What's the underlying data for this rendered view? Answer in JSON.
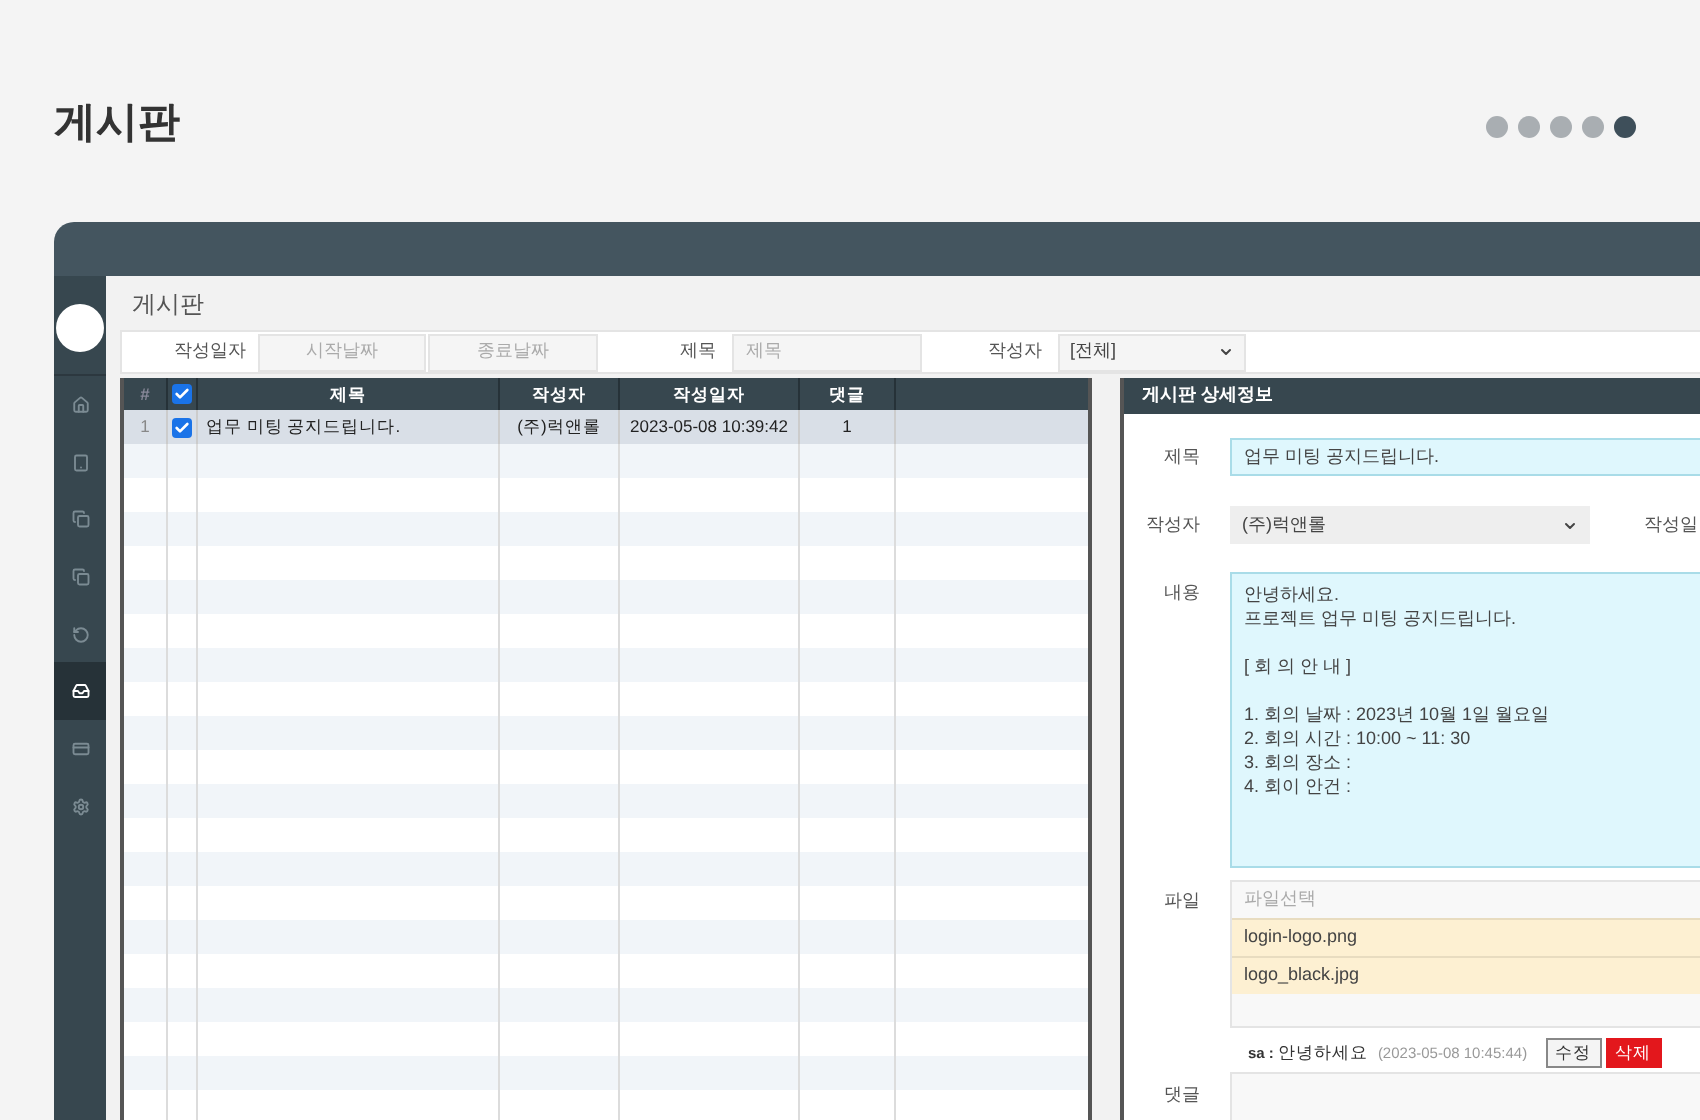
{
  "page_title": "게시판",
  "pager_dots": [
    {
      "selected": false
    },
    {
      "selected": false
    },
    {
      "selected": false
    },
    {
      "selected": false
    },
    {
      "selected": true
    }
  ],
  "sidebar": {
    "items": [
      {
        "selected": false
      },
      {
        "selected": false
      },
      {
        "selected": false
      },
      {
        "selected": false
      },
      {
        "selected": false
      },
      {
        "selected": true
      },
      {
        "selected": false
      },
      {
        "selected": false
      }
    ]
  },
  "board_title": "게시판",
  "filters": {
    "date_label": "작성일자",
    "start_placeholder": "시작날짜",
    "end_placeholder": "종료날짜",
    "title_label": "제목",
    "title_placeholder": "제목",
    "author_label": "작성자",
    "author_value": "[전체]"
  },
  "table": {
    "columns": [
      "#",
      "제목",
      "작성자",
      "작성일자",
      "댓글"
    ],
    "header_checked": true,
    "rows": [
      {
        "num": "1",
        "checked": true,
        "selected": true,
        "title": "업무 미팅 공지드립니다.",
        "author": "(주)럭앤롤",
        "date": "2023-05-08 10:39:42",
        "comments": "1"
      }
    ]
  },
  "detail": {
    "header": "게시판 상세정보",
    "title_label": "제목",
    "title_value": "업무 미팅 공지드립니다.",
    "author_label": "작성자",
    "author_value": "(주)럭앤롤",
    "date_label": "작성일",
    "content_label": "내용",
    "content_paragraphs": [
      [
        "안녕하세요.",
        "프로젝트 업무 미팅 공지드립니다."
      ],
      [
        "[ 회 의 안 내 ]"
      ],
      [
        "1. 회의 날짜 : 2023년 10월 1일 월요일",
        "2. 회의 시간 : 10:00 ~ 11: 30",
        "3. 회의 장소 :",
        "4. 회이 안건 :"
      ]
    ],
    "file_label": "파일",
    "file_placeholder": "파일선택",
    "files": [
      "login-logo.png",
      "logo_black.jpg"
    ],
    "comment": {
      "user": "sa :",
      "text": "안녕하세요",
      "time": "(2023-05-08 10:45:44)",
      "edit": "수정",
      "delete": "삭제"
    },
    "comment_label": "댓글"
  }
}
